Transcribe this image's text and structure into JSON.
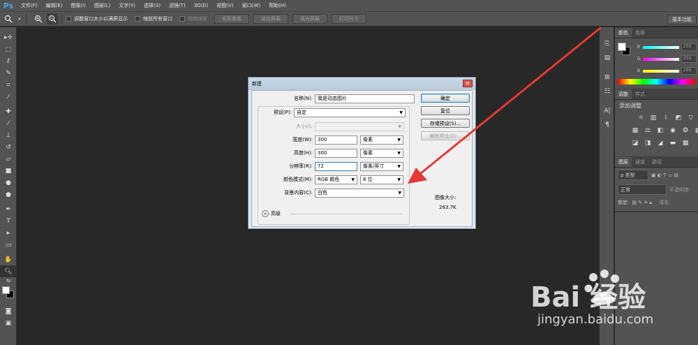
{
  "app": {
    "logo": "Ps"
  },
  "menu": [
    "文件(F)",
    "编辑(E)",
    "图像(I)",
    "图层(L)",
    "文字(Y)",
    "选择(S)",
    "滤镜(T)",
    "3D(D)",
    "视图(V)",
    "窗口(W)",
    "帮助(H)"
  ],
  "options": {
    "resize_window": "调整窗口大小以满屏显示",
    "zoom_all": "缩放所有窗口",
    "scrubby_zoom": "细微缩放",
    "actual_pixels": "实际像素",
    "fit_screen": "适合屏幕",
    "fill_screen": "填充屏幕",
    "print_size": "打印尺寸",
    "workspace": "基本功能"
  },
  "panels": {
    "color_tab": "颜色",
    "swatches_tab": "色板",
    "channels": [
      {
        "label": "R",
        "value": "255"
      },
      {
        "label": "G",
        "value": "255"
      },
      {
        "label": "B",
        "value": "255"
      }
    ],
    "adjust_tab": "调整",
    "styles_tab": "样式",
    "adjust_title": "添加调整",
    "layers_tab": "图层",
    "channels_tab": "通道",
    "paths_tab": "路径",
    "kind_filter": "ρ 类型",
    "blend_mode": "正常",
    "opacity_label": "不透明度:",
    "lock_label": "锁定:",
    "fill_label": "填充:"
  },
  "dialog": {
    "title": "新建",
    "name_label": "名称(N):",
    "name_value": "我是动态图片",
    "preset_label": "预设(P):",
    "preset_value": "自定",
    "size_label": "大小(I):",
    "width_label": "宽度(W):",
    "width_value": "300",
    "width_unit": "像素",
    "height_label": "高度(H):",
    "height_value": "300",
    "height_unit": "像素",
    "resolution_label": "分辨率(R):",
    "resolution_value": "72",
    "resolution_unit": "像素/英寸",
    "color_mode_label": "颜色模式(M):",
    "color_mode_value": "RGB 颜色",
    "bit_depth": "8 位",
    "background_label": "背景内容(C):",
    "background_value": "白色",
    "advanced_label": "高级",
    "ok": "确定",
    "reset": "复位",
    "save_preset": "存储预设(S)...",
    "delete_preset": "删除预设(D)...",
    "image_size_label": "图像大小:",
    "image_size_value": "263.7K"
  },
  "watermark": {
    "brand": "Bai 经验",
    "url": "jingyan.baidu.com"
  },
  "colors": {
    "accent_arrow": "#e53935",
    "ps_blue": "#4aa3e8"
  }
}
